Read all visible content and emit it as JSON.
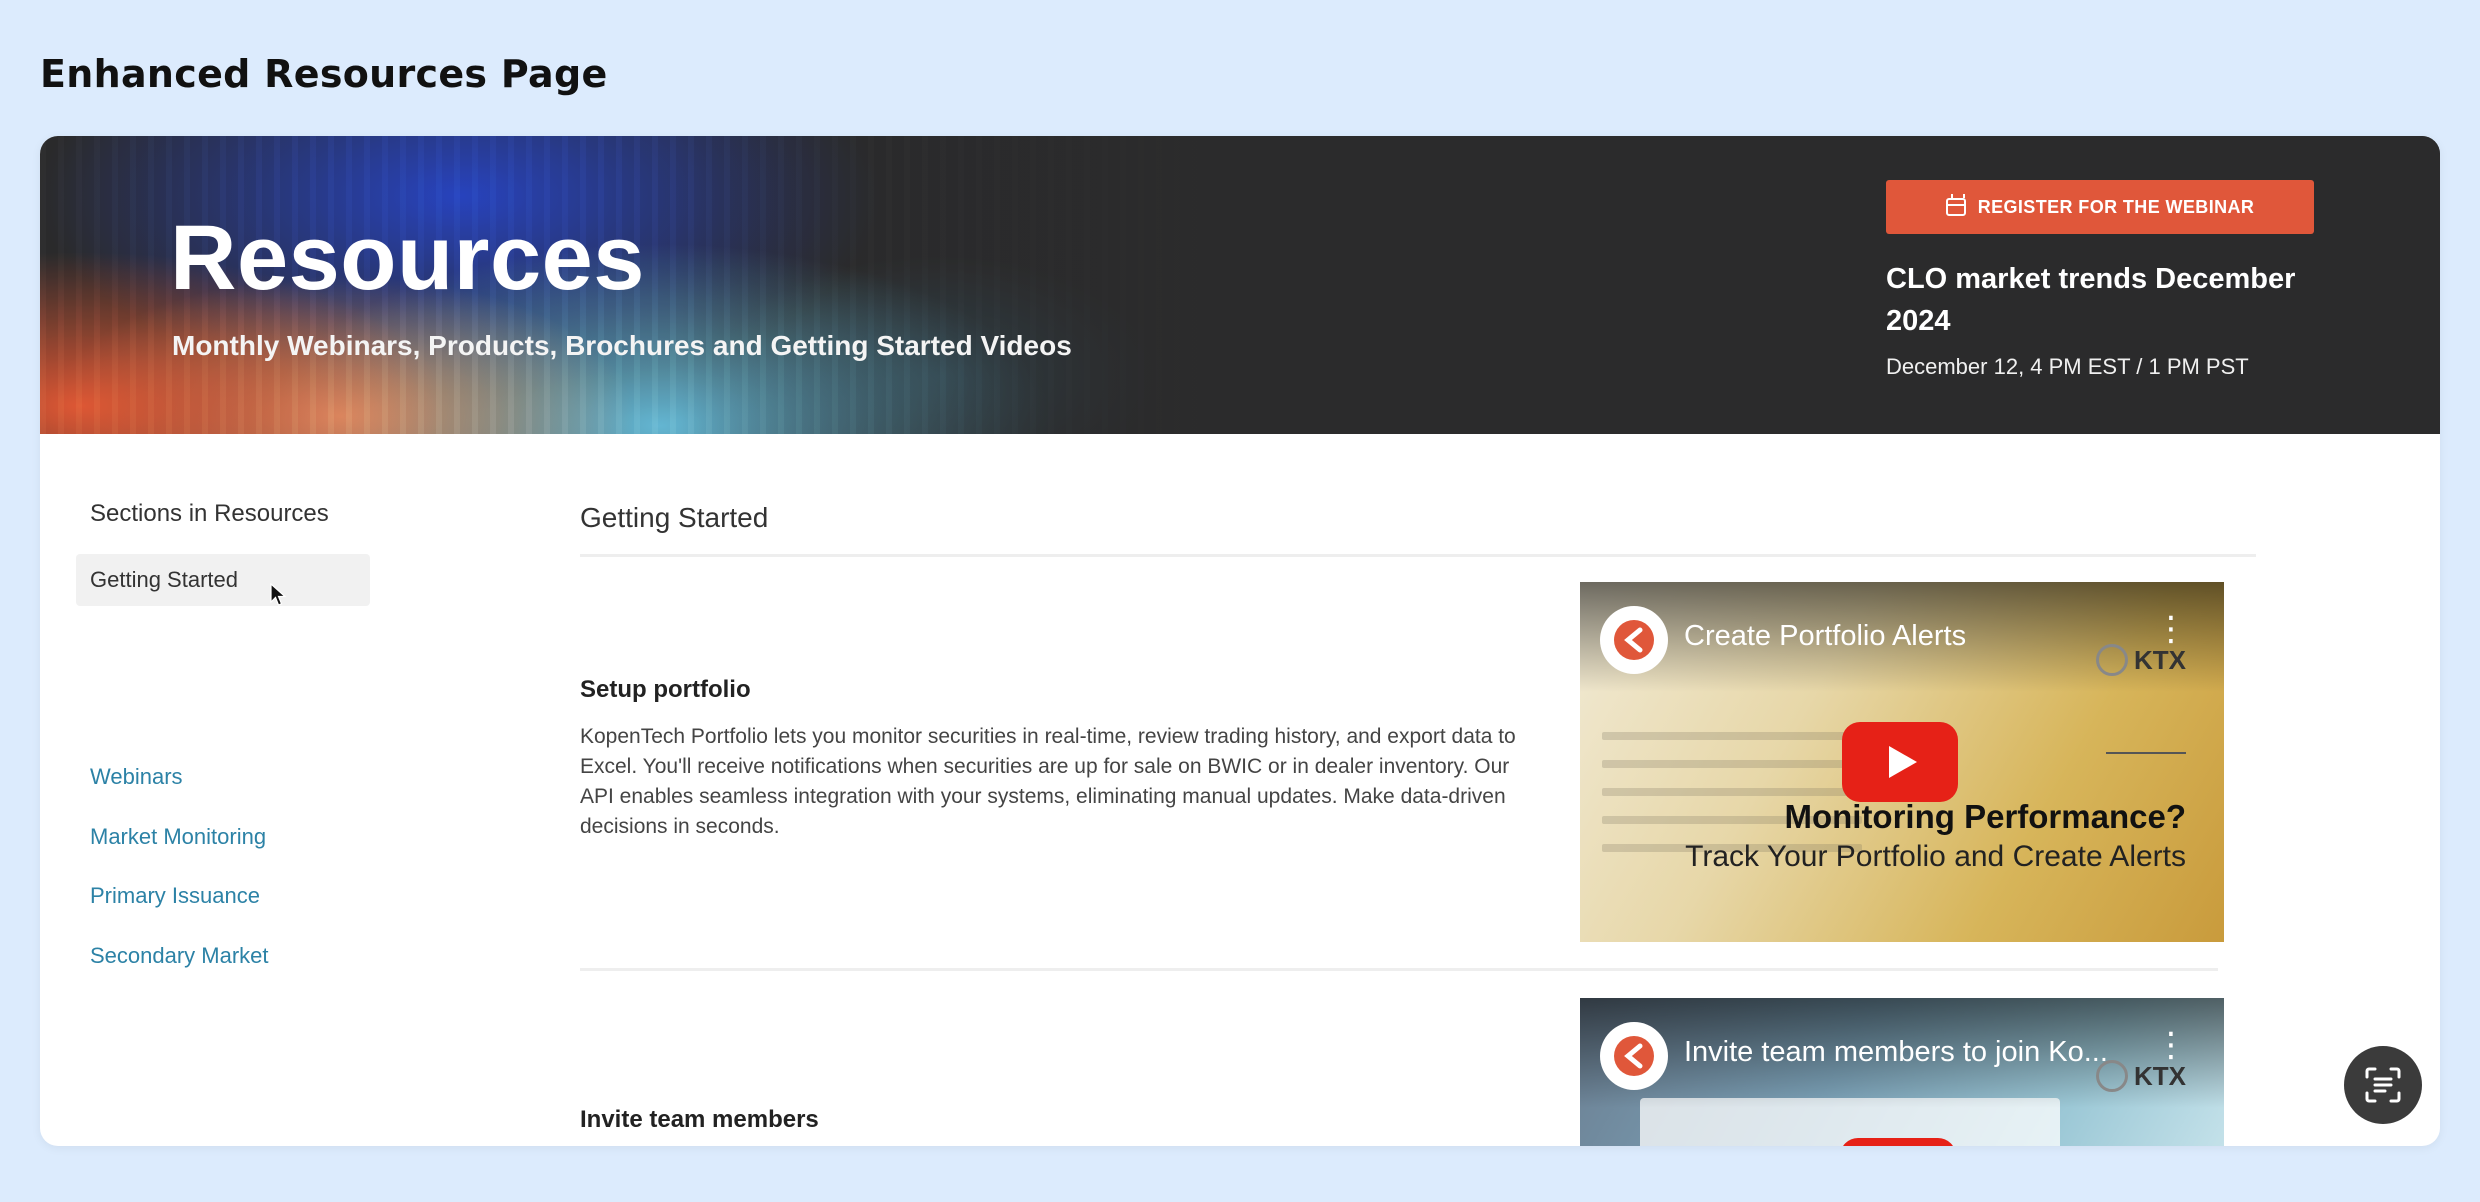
{
  "page_heading": "Enhanced Resources Page",
  "hero": {
    "title": "Resources",
    "subtitle": "Monthly Webinars, Products, Brochures and Getting Started Videos",
    "webinar_button": "REGISTER FOR THE WEBINAR",
    "webinar_title": "CLO market trends December 2024",
    "webinar_date": "December 12, 4 PM EST / 1 PM PST"
  },
  "sidebar": {
    "title": "Sections in Resources",
    "items": [
      {
        "label": "Getting Started",
        "active": true
      },
      {
        "label": "Webinars"
      },
      {
        "label": "Market Monitoring"
      },
      {
        "label": "Primary Issuance"
      },
      {
        "label": "Secondary Market"
      }
    ]
  },
  "content": {
    "section_title": "Getting Started",
    "items": [
      {
        "title": "Setup portfolio",
        "description": "KopenTech Portfolio lets you monitor securities in real-time, review trading history, and export data to Excel. You'll receive notifications when securities are up for sale on BWIC or in dealer inventory. Our API enables seamless integration with your systems, eliminating manual updates. Make data-driven decisions in seconds.",
        "video": {
          "title": "Create Portfolio Alerts",
          "brand": "KTX",
          "thumb_line1": "Monitoring Performance?",
          "thumb_line2": "Track Your Portfolio and Create Alerts"
        }
      },
      {
        "title": "Invite team members",
        "video": {
          "title": "Invite team members to join Ko...",
          "brand": "KTX"
        }
      }
    ]
  },
  "colors": {
    "accent": "#e0573a",
    "link": "#2c82a6",
    "page_bg": "#dcebfd",
    "hero_bg": "#2b2b2c"
  },
  "icons": {
    "button": "calendar-icon",
    "fab": "scan-text-icon",
    "video": "play-icon"
  }
}
